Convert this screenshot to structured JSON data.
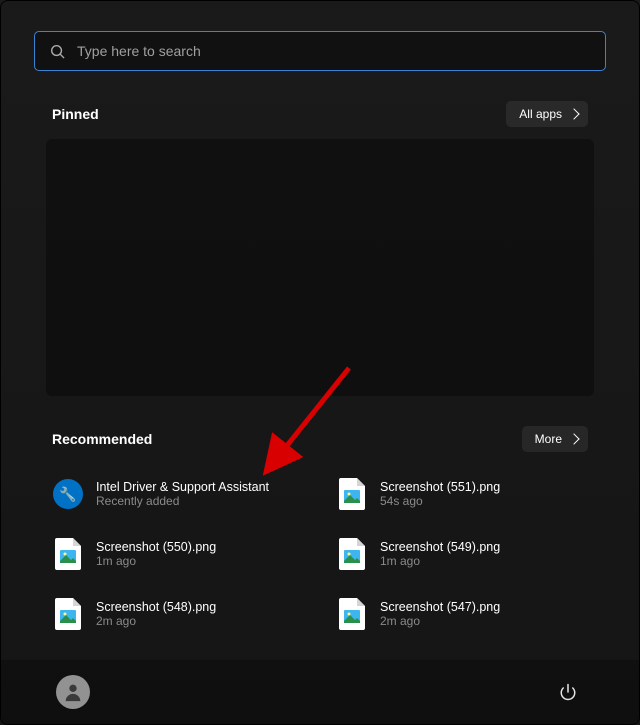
{
  "search": {
    "placeholder": "Type here to search"
  },
  "pinned": {
    "title": "Pinned",
    "all_apps_label": "All apps"
  },
  "recommended": {
    "title": "Recommended",
    "more_label": "More",
    "items": [
      {
        "title": "Intel Driver & Support Assistant",
        "subtitle": "Recently added",
        "icon": "intel"
      },
      {
        "title": "Screenshot (551).png",
        "subtitle": "54s ago",
        "icon": "image-file"
      },
      {
        "title": "Screenshot (550).png",
        "subtitle": "1m ago",
        "icon": "image-file"
      },
      {
        "title": "Screenshot (549).png",
        "subtitle": "1m ago",
        "icon": "image-file"
      },
      {
        "title": "Screenshot (548).png",
        "subtitle": "2m ago",
        "icon": "image-file"
      },
      {
        "title": "Screenshot (547).png",
        "subtitle": "2m ago",
        "icon": "image-file"
      }
    ]
  }
}
